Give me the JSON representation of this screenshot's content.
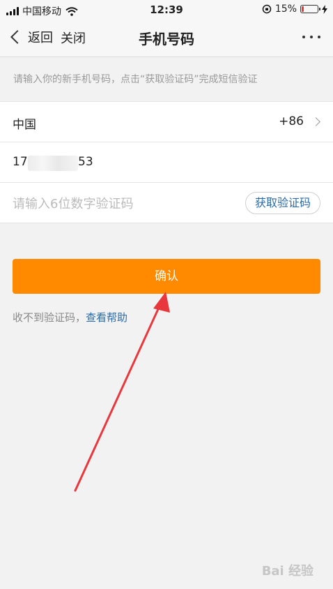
{
  "status_bar": {
    "carrier": "中国移动",
    "time": "12:39",
    "battery_text": "15%",
    "battery_level": 0.15,
    "battery_color": "#e23b3b"
  },
  "nav": {
    "back_label": "返回",
    "close_label": "关闭",
    "title": "手机号码"
  },
  "hint": "请输入你的新手机号码，点击“获取验证码”完成短信验证",
  "country": {
    "name": "中国",
    "code": "+86"
  },
  "phone": {
    "head": "17",
    "tail": "53"
  },
  "code": {
    "placeholder": "请输入6位数字验证码",
    "button": "获取验证码"
  },
  "confirm_label": "确认",
  "help": {
    "text": "收不到验证码，",
    "link": "查看帮助"
  },
  "watermark": "Bai 经验",
  "colors": {
    "accent": "#ff8a00",
    "link": "#2b6aa8",
    "arrow": "#e8383d"
  }
}
